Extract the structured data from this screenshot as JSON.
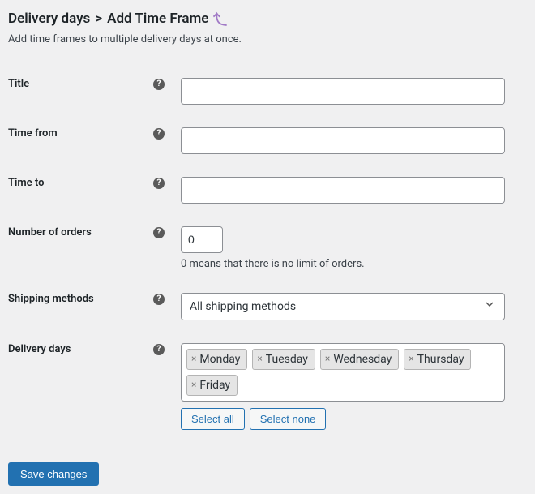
{
  "header": {
    "breadcrumb_parent": "Delivery days",
    "breadcrumb_separator": ">",
    "title": "Add Time Frame"
  },
  "description": "Add time frames to multiple delivery days at once.",
  "fields": {
    "title": {
      "label": "Title",
      "value": ""
    },
    "time_from": {
      "label": "Time from",
      "value": ""
    },
    "time_to": {
      "label": "Time to",
      "value": ""
    },
    "num_orders": {
      "label": "Number of orders",
      "value": "0",
      "hint": "0 means that there is no limit of orders."
    },
    "shipping_methods": {
      "label": "Shipping methods",
      "selected": "All shipping methods"
    },
    "delivery_days": {
      "label": "Delivery days",
      "selected": [
        "Monday",
        "Tuesday",
        "Wednesday",
        "Thursday",
        "Friday"
      ],
      "select_all_label": "Select all",
      "select_none_label": "Select none"
    }
  },
  "submit": {
    "label": "Save changes"
  },
  "icons": {
    "help": "?",
    "chip_remove": "×"
  }
}
